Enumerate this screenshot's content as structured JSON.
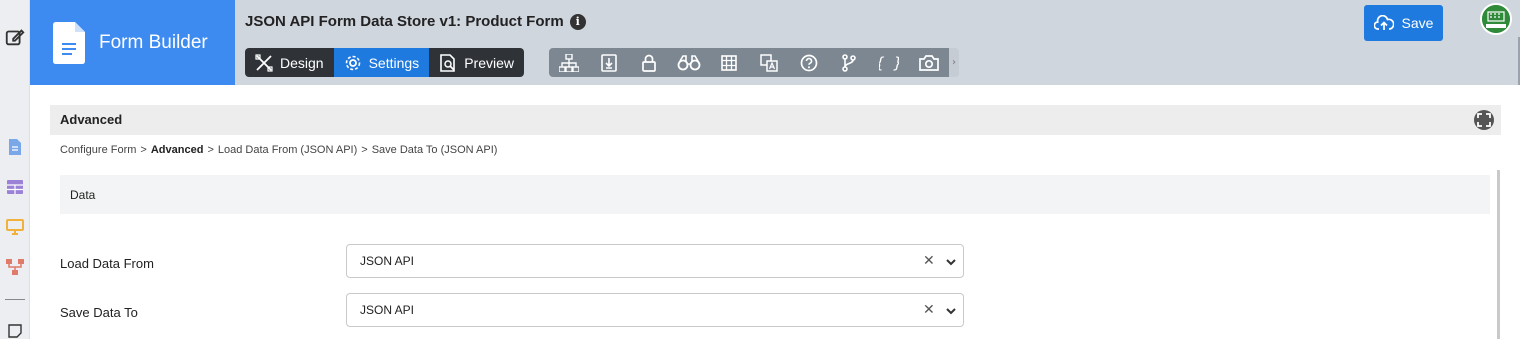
{
  "app": {
    "brand_label": "Form Builder",
    "form_title": "JSON API Form Data Store v1: Product Form",
    "info_glyph": "i"
  },
  "modes": [
    {
      "label": "Design",
      "icon": "design-tools-icon"
    },
    {
      "label": "Settings",
      "icon": "gear-icon",
      "active": true
    },
    {
      "label": "Preview",
      "icon": "preview-doc-icon"
    }
  ],
  "toolbar_icons": [
    "sitemap-icon",
    "import-icon",
    "lock-icon",
    "binoculars-icon",
    "grid-icon",
    "translate-icon",
    "help-icon",
    "branch-icon",
    "braces-icon",
    "camera-icon"
  ],
  "toolbar_more": "›",
  "save_button": {
    "label": "Save"
  },
  "section": {
    "title": "Advanced"
  },
  "breadcrumb": {
    "items": [
      "Configure Form",
      "Advanced",
      "Load Data From (JSON API)",
      "Save Data To (JSON API)"
    ],
    "separator": ">"
  },
  "panel": {
    "title": "Data"
  },
  "fields": [
    {
      "label": "Load Data From",
      "value": "JSON API",
      "clear": "✕"
    },
    {
      "label": "Save Data To",
      "value": "JSON API",
      "clear": "✕"
    }
  ],
  "colors": {
    "brand": "#3d8af0",
    "header": "#d0d6de",
    "primary": "#1f7ae0",
    "dark": "#2f3338",
    "toolbar": "#7d8792"
  }
}
